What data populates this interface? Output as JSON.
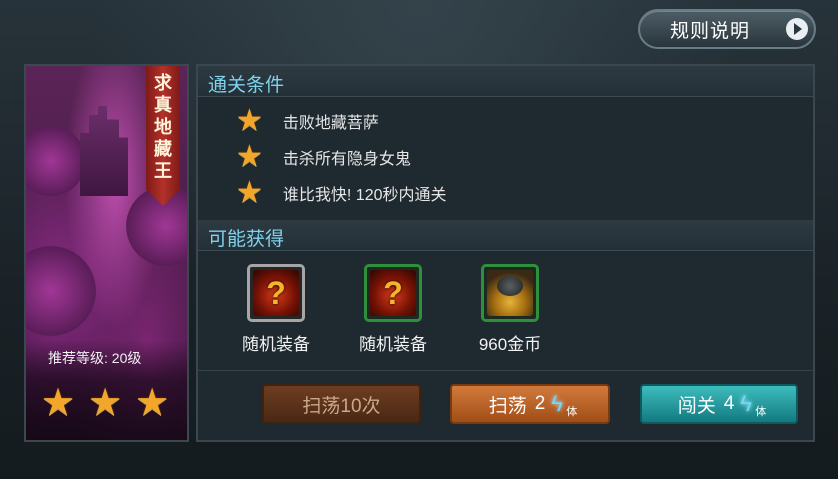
{
  "header": {
    "rules_label": "规则说明"
  },
  "stage": {
    "name_chars": [
      "求",
      "真",
      "地",
      "藏",
      "王"
    ],
    "recommended_level_label": "推荐等级: 20级",
    "stars_earned": 3,
    "stars_total": 3
  },
  "conditions": {
    "title": "通关条件",
    "items": [
      {
        "text": "击败地藏菩萨"
      },
      {
        "text": "击杀所有隐身女鬼"
      },
      {
        "text": "谁比我快! 120秒内通关"
      }
    ]
  },
  "rewards": {
    "title": "可能获得",
    "items": [
      {
        "name": "随机装备",
        "icon": "random-equipment-icon",
        "frame": "grey"
      },
      {
        "name": "随机装备",
        "icon": "random-equipment-icon",
        "frame": "green"
      },
      {
        "name": "960金币",
        "icon": "gold-coins-icon",
        "frame": "green"
      }
    ]
  },
  "actions": {
    "sweep10_label": "扫荡10次",
    "sweep_label": "扫荡",
    "sweep_cost": "2",
    "battle_label": "闯关",
    "battle_cost": "4",
    "stamina_unit": "体"
  },
  "colors": {
    "section_title": "#7fd2ec",
    "star": "#f2a72b",
    "sweep_button": "#c46a2e",
    "battle_button": "#26a3a8"
  }
}
